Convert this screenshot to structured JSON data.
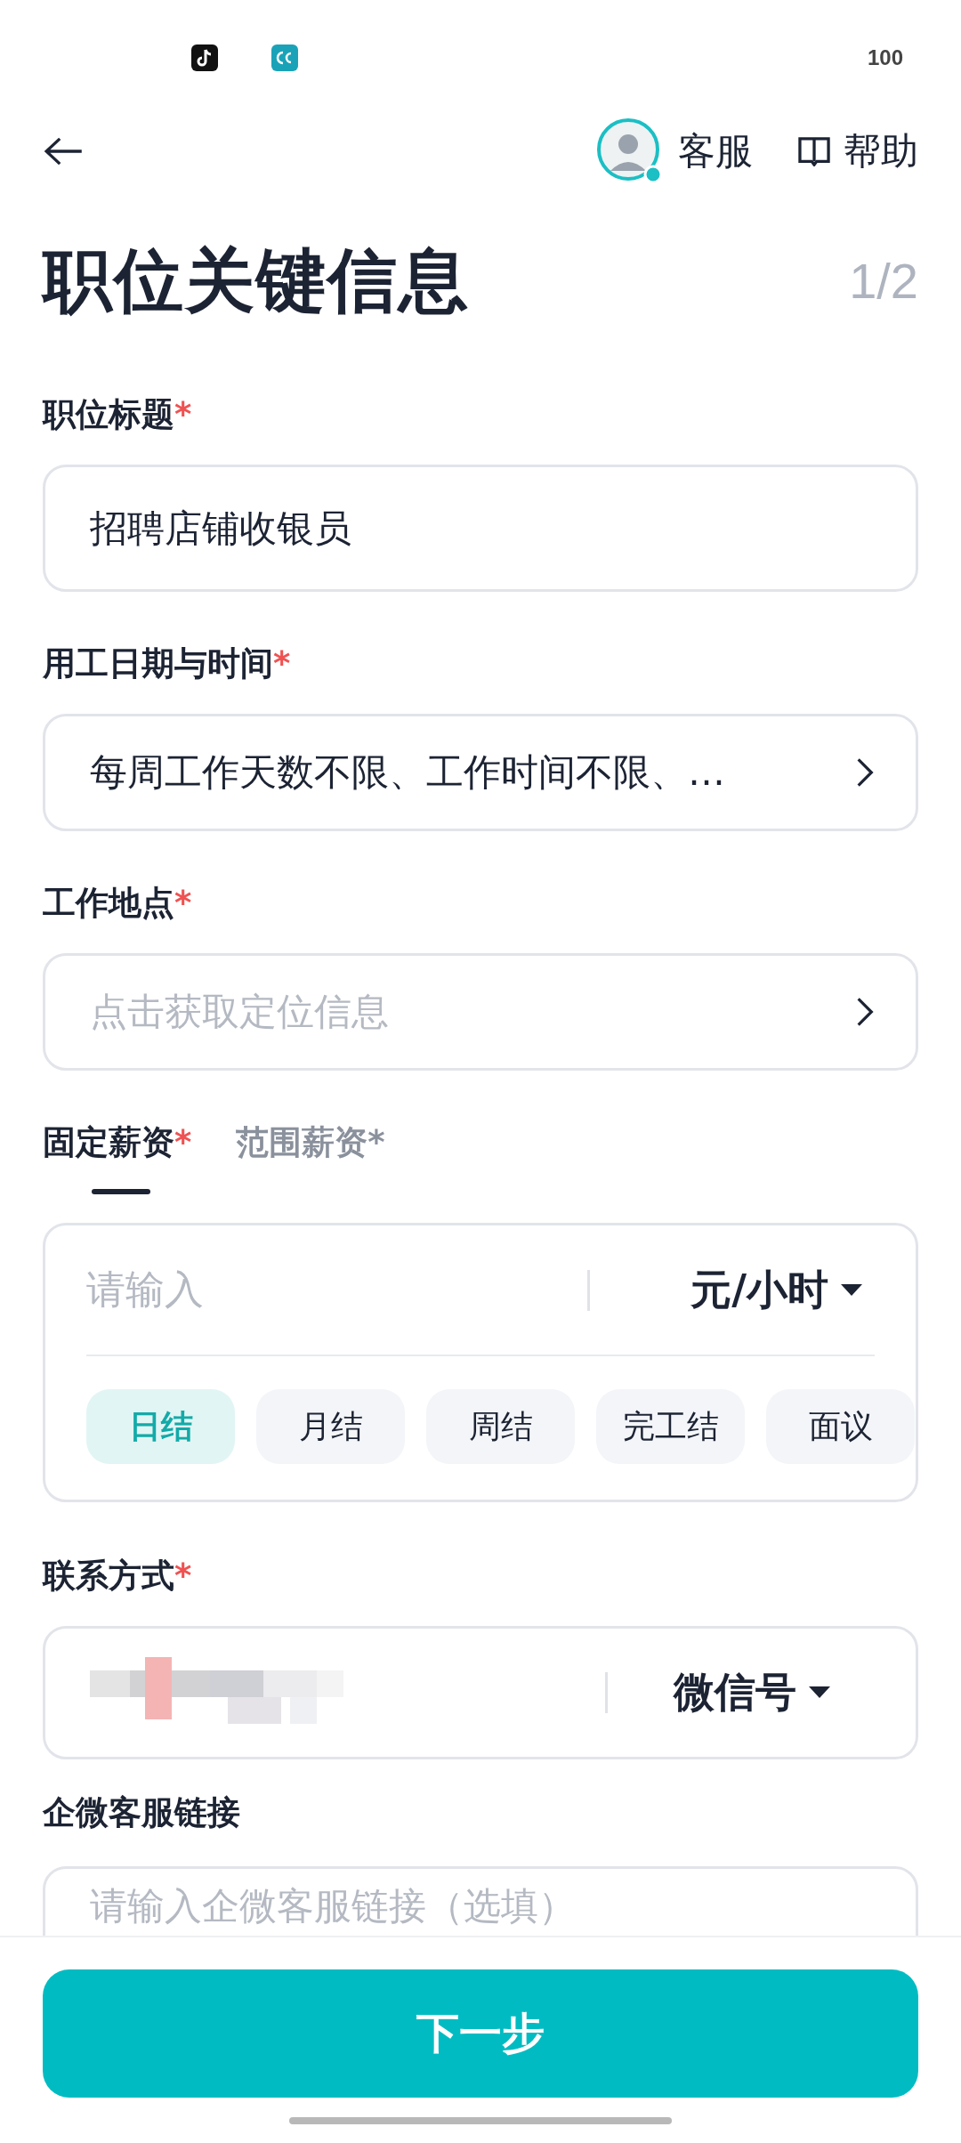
{
  "status_bar": {
    "battery": "100"
  },
  "header": {
    "service": "客服",
    "help": "帮助"
  },
  "title": "职位关键信息",
  "step": "1/2",
  "fields": [
    {
      "kind": "text",
      "label": "职位标题",
      "marker": "*",
      "value": "招聘店铺收银员"
    },
    {
      "kind": "select",
      "label": "用工日期与时间",
      "marker": "*",
      "value": "每周工作天数不限、工作时间不限、…"
    },
    {
      "kind": "select",
      "label": "工作地点",
      "marker": "*",
      "placeholder": "点击获取定位信息"
    }
  ],
  "salary": {
    "tabs": [
      {
        "label": "固定薪资",
        "marker": "*",
        "selected": true
      },
      {
        "label": "范围薪资",
        "marker": "*",
        "selected": false
      }
    ],
    "placeholder": "请输入",
    "unit": "元/小时",
    "chips": [
      {
        "label": "日结",
        "selected": true
      },
      {
        "label": "月结",
        "selected": false
      },
      {
        "label": "周结",
        "selected": false
      },
      {
        "label": "完工结",
        "selected": false
      },
      {
        "label": "面议",
        "selected": false
      }
    ]
  },
  "contact": {
    "label": "联系方式",
    "marker": "*",
    "type": "微信号"
  },
  "link": {
    "label": "企微客服链接",
    "placeholder": "请输入企微客服链接（选填）"
  },
  "next_button": "下一步"
}
